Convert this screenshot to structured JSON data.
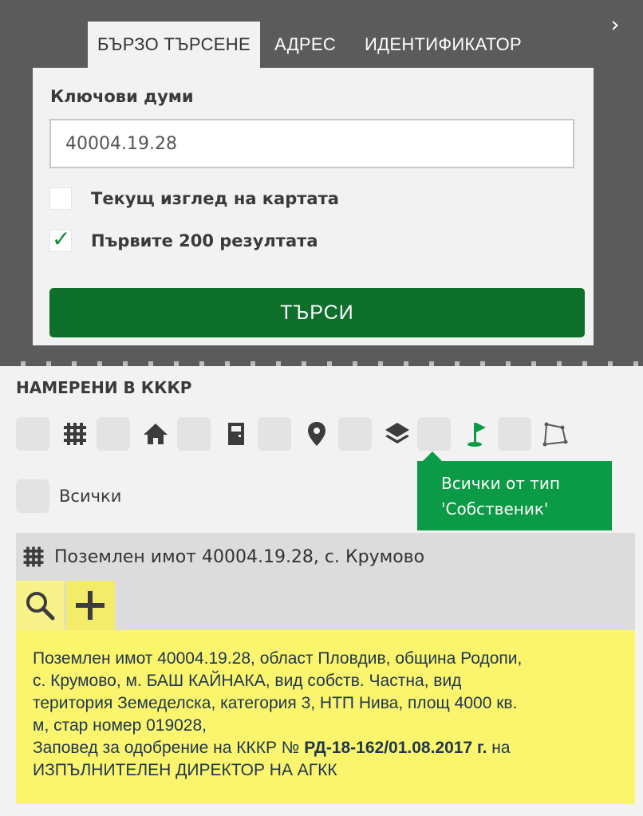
{
  "panel": {
    "collapse_icon": "chevron-right-icon",
    "tabs": [
      {
        "label": "БЪРЗО ТЪРСЕНЕ",
        "active": true
      },
      {
        "label": "АДРЕС",
        "active": false
      },
      {
        "label": "ИДЕНТИФИКАТОР",
        "active": false
      }
    ]
  },
  "form": {
    "keywords_label": "Ключови думи",
    "keywords_value": "40004.19.28",
    "options": [
      {
        "label": "Текущ изглед на картата",
        "checked": false
      },
      {
        "label": "Първите 200 резултата",
        "checked": true
      }
    ],
    "checkmark": "✓",
    "search_label": "ТЪРСИ"
  },
  "results": {
    "title": "НАМЕРЕНИ В КККР",
    "filter_icons": [
      "grid-icon",
      "home-icon",
      "building-icon",
      "location-pin-icon",
      "layers-icon",
      "flag-icon",
      "polygon-icon"
    ],
    "tooltip_lines": [
      "Всички от тип",
      "'Собственик'"
    ],
    "all_label": "Всички",
    "accent_color": "#0b9a45",
    "item": {
      "title": "Поземлен имот 40004.19.28, с. Крумово",
      "lines": [
        "Поземлен имот 40004.19.28, област Пловдив, община Родопи,",
        "с. Крумово, м. БАШ КАЙНАКА, вид собств. Частна, вид",
        "територия Земеделска, категория 3, НТП Нива, площ 4000 кв.",
        "м, стар номер 019028,"
      ],
      "order_prefix": "Заповед за одобрение на КККР № ",
      "order_number": "РД-18-162/01.08.2017 г.",
      "order_suffix": " на",
      "issuer": "ИЗПЪЛНИТЕЛЕН ДИРЕКТОР НА АГКК"
    }
  }
}
